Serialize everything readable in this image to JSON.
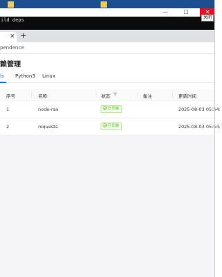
{
  "terminal": {
    "text": "ild deps",
    "tooltip": "关闭",
    "minimize_glyph": "—",
    "maximize_glyph": "☐",
    "close_glyph": "✕"
  },
  "browser": {
    "tab_close_glyph": "✕",
    "new_tab_glyph": "+",
    "address": "pendence"
  },
  "page": {
    "title": "赖管理",
    "tabs": [
      {
        "label": "ls",
        "active": true
      },
      {
        "label": "Python3",
        "active": false
      },
      {
        "label": "Linux",
        "active": false
      }
    ]
  },
  "table": {
    "columns": [
      "序号",
      "名称",
      "状态",
      "备注",
      "更新时间"
    ],
    "rows": [
      {
        "index": "1",
        "name": "node-rsa",
        "status": "已安装",
        "remark": "",
        "updated": "2025-08-03 05:54:"
      },
      {
        "index": "2",
        "name": "requests",
        "status": "已安装",
        "remark": "",
        "updated": "2025-08-03 05:54:"
      }
    ]
  },
  "colors": {
    "accent": "#1677ff",
    "success": "#52c41a",
    "close_red": "#e81123"
  }
}
